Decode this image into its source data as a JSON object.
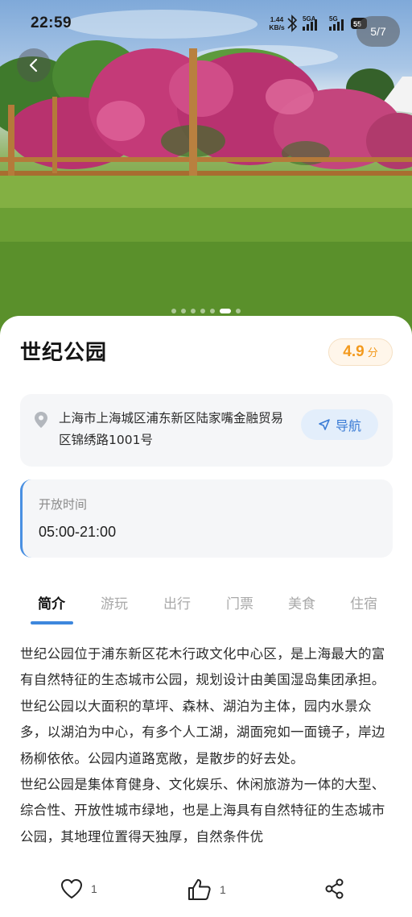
{
  "status_bar": {
    "time": "22:59",
    "speed_value": "1.44",
    "speed_unit": "KB/s",
    "network_1": "5GA",
    "network_2": "5G",
    "battery": "55"
  },
  "gallery": {
    "counter": "5/7",
    "total_images": 7,
    "active_dot_index": 5
  },
  "place": {
    "name": "世纪公园",
    "rating_value": "4.9",
    "rating_unit": "分"
  },
  "address": {
    "text": "上海市上海城区浦东新区陆家嘴金融贸易区锦绣路1001号",
    "nav_label": "导航"
  },
  "hours": {
    "label": "开放时间",
    "value": "05:00-21:00"
  },
  "tabs": [
    {
      "label": "简介",
      "active": true
    },
    {
      "label": "游玩",
      "active": false
    },
    {
      "label": "出行",
      "active": false
    },
    {
      "label": "门票",
      "active": false
    },
    {
      "label": "美食",
      "active": false
    },
    {
      "label": "住宿",
      "active": false
    }
  ],
  "description": {
    "paragraph_1": "世纪公园位于浦东新区花木行政文化中心区，是上海最大的富有自然特征的生态城市公园，规划设计由美国湿岛集团承担。世纪公园以大面积的草坪、森林、湖泊为主体，园内水景众多，以湖泊为中心，有多个人工湖，湖面宛如一面镜子，岸边杨柳依依。公园内道路宽敞，是散步的好去处。",
    "paragraph_2": "世纪公园是集体育健身、文化娱乐、休闲旅游为一体的大型、综合性、开放性城市绿地，也是上海具有自然特征的生态城市公园，其地理位置得天独厚，自然条件优"
  },
  "actions": {
    "like_count": "1",
    "thumbs_count": "1"
  },
  "colors": {
    "accent": "#3d87dd",
    "rating": "#f39a1e",
    "card_bg": "#f5f6f8"
  },
  "icons": {
    "back": "chevron-left-icon",
    "pin": "location-pin-icon",
    "navigate": "navigation-arrow-icon",
    "like": "heart-icon",
    "thumbs": "thumbs-up-icon",
    "share": "share-icon"
  }
}
